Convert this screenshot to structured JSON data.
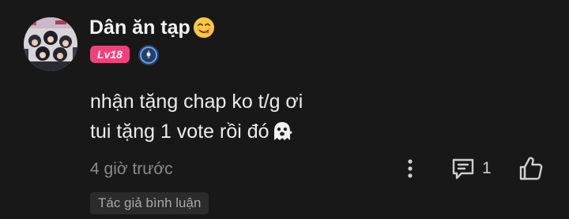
{
  "comment": {
    "author": {
      "name": "Dân ăn tạp",
      "name_emoji_icon": "yum-face-emoji-icon",
      "level": "Lv18",
      "verify_icon": "verified-badge-icon",
      "avatar": "group-photo-avatar"
    },
    "lines": [
      {
        "text": "nhận tặng chap ko t/g ơi"
      },
      {
        "text": "tui tặng 1 vote rồi đó",
        "trailing_icon": "ghost-emoji-icon"
      }
    ],
    "timestamp": "4 giờ trước",
    "actions": {
      "more_icon": "more-vertical-icon",
      "reply_icon": "comment-icon",
      "reply_count": "1",
      "like_icon": "thumbs-up-icon"
    },
    "tag": "Tác giả bình luận"
  },
  "colors": {
    "background": "#181818",
    "level_badge": "#f0417d",
    "verify_badge": "#5aa3ff",
    "muted_text": "#8a8a8a"
  }
}
